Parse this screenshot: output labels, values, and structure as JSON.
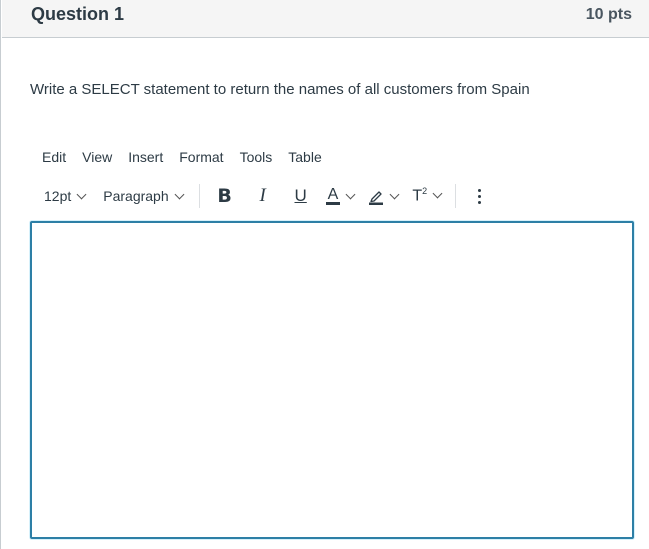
{
  "question": {
    "title": "Question 1",
    "points": "10 pts",
    "prompt": "Write a SELECT statement to return the names of all customers from Spain"
  },
  "editor": {
    "menubar": [
      "Edit",
      "View",
      "Insert",
      "Format",
      "Tools",
      "Table"
    ],
    "toolbar": {
      "font_size": "12pt",
      "block_format": "Paragraph",
      "bold_label": "B",
      "italic_label": "I",
      "underline_label": "U",
      "text_color_label": "A",
      "superscript_label": "T",
      "superscript_sup": "2",
      "icons": {
        "bold": "bold-icon",
        "italic": "italic-icon",
        "underline": "underline-icon",
        "text_color": "text-color-icon",
        "highlight": "highlight-pen-icon",
        "superscript": "superscript-icon",
        "more": "vertical-ellipsis-icon"
      }
    },
    "content": "",
    "colors": {
      "focus_border": "#2d7fa6",
      "header_bg": "#f5f5f5",
      "text": "#2d3b45"
    }
  }
}
